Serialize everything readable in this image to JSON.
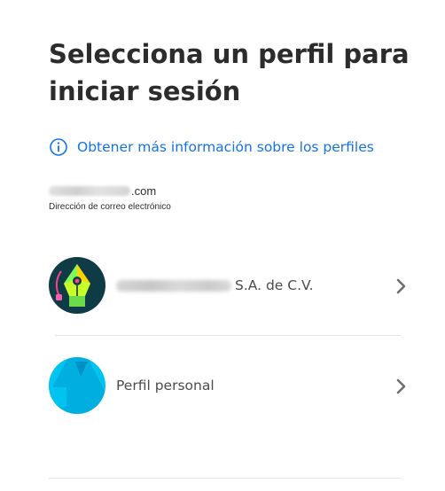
{
  "header": {
    "title": "Selecciona un perfil para iniciar sesión"
  },
  "info": {
    "icon": "info-circle-icon",
    "link_label": "Obtener más información sobre los perfiles"
  },
  "account": {
    "email_domain_suffix": ".com",
    "email_label": "Dirección de correo electrónico"
  },
  "profiles": [
    {
      "name_suffix": "S.A. de C.V.",
      "avatar": "organization-avatar-icon",
      "chevron": "chevron-right-icon"
    },
    {
      "name": "Perfil personal",
      "avatar": "personal-avatar-icon",
      "chevron": "chevron-right-icon"
    }
  ],
  "colors": {
    "accent": "#1473e6",
    "text": "#2c2c2c",
    "personal_avatar": "#00c4f0",
    "org_avatar_bg": "#0e3b46"
  }
}
